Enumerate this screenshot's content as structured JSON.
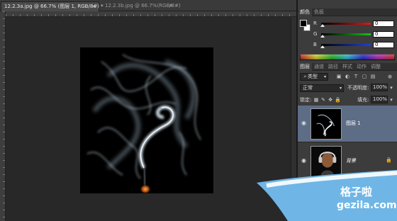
{
  "tabs": {
    "active": "12.2.3a.jpg @ 66.7% (图层 1, RGB/8#) *",
    "inactive": "12.2.3b.jpg @ 66.7%(RGB/8#)",
    "close_glyph": "×"
  },
  "color_panel": {
    "tabs": [
      "颜色",
      "色板"
    ],
    "sliders": [
      {
        "label": "R",
        "value": "0",
        "track_color": "#c02020"
      },
      {
        "label": "G",
        "value": "0",
        "track_color": "#20a020"
      },
      {
        "label": "B",
        "value": "0",
        "track_color": "#2040c0"
      }
    ],
    "foreground": "#000000",
    "background": "#ffffff"
  },
  "layers_panel": {
    "tabs": [
      "图层",
      "通道",
      "路径",
      "样式",
      "动作",
      "调整"
    ],
    "filter_type": "类型",
    "blend_mode": "正常",
    "opacity_label": "不透明度:",
    "opacity_value": "100%",
    "lock_label": "锁定:",
    "fill_label": "填充:",
    "fill_value": "100%",
    "layers": [
      {
        "name": "图层 1",
        "selected": true,
        "visible": true
      },
      {
        "name": "背景",
        "selected": false,
        "visible": true
      }
    ]
  },
  "watermark": {
    "cn": "格子啦",
    "en": "gezila.com"
  },
  "icons": [
    "eye-icon",
    "lock-icon",
    "filter-icon",
    "chevron-down-icon"
  ]
}
